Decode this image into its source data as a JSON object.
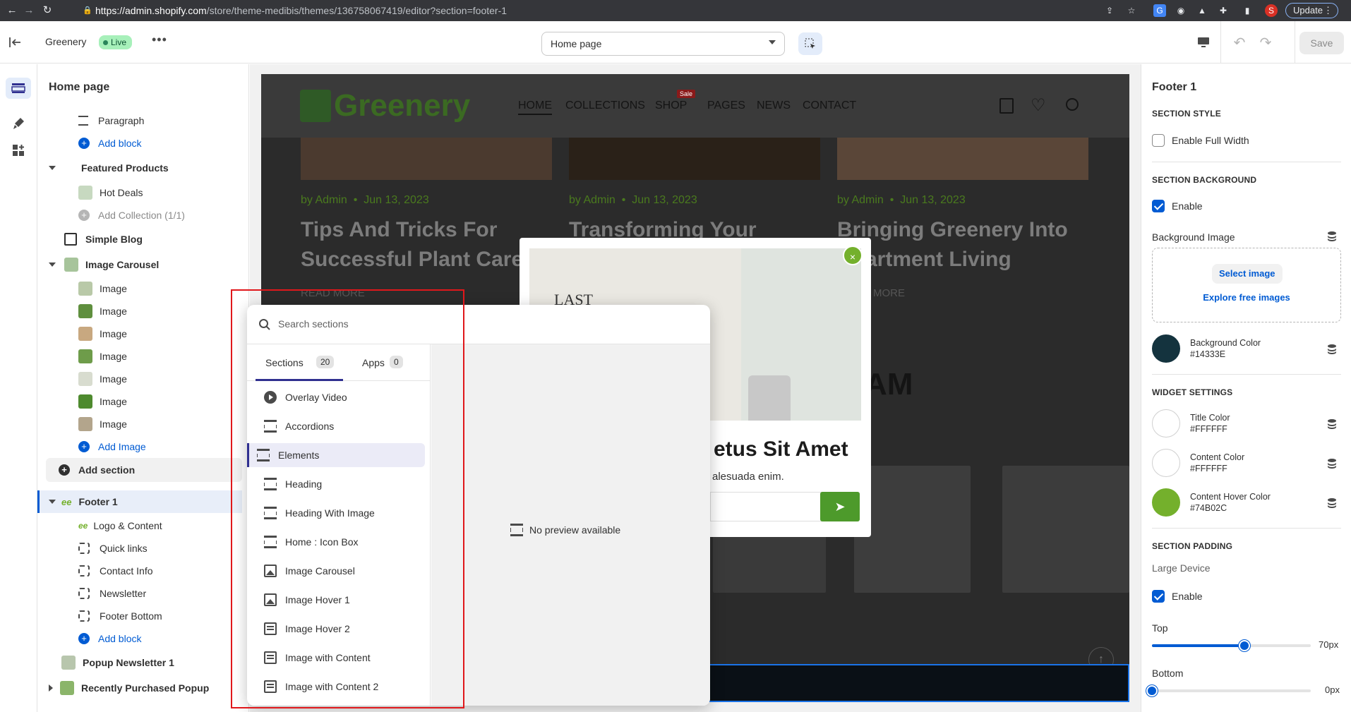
{
  "browser": {
    "url_host": "https://admin.shopify.com",
    "url_path": "/store/theme-medibis/themes/136758067419/editor?section=footer-1",
    "update_label": "Update",
    "profile_initial": "S"
  },
  "topbar": {
    "store_name": "Greenery",
    "status_badge": "Live",
    "page_select": "Home page",
    "save_label": "Save"
  },
  "left_panel": {
    "title": "Home page",
    "items": [
      {
        "label": "Paragraph"
      },
      {
        "label": "Add block"
      },
      {
        "label": "Featured Products"
      },
      {
        "label": "Hot Deals"
      },
      {
        "label": "Add Collection (1/1)"
      },
      {
        "label": "Simple Blog"
      },
      {
        "label": "Image Carousel"
      },
      {
        "label": "Image"
      },
      {
        "label": "Image"
      },
      {
        "label": "Image"
      },
      {
        "label": "Image"
      },
      {
        "label": "Image"
      },
      {
        "label": "Image"
      },
      {
        "label": "Image"
      },
      {
        "label": "Add Image"
      },
      {
        "label": "Add section"
      },
      {
        "label": "Footer 1"
      },
      {
        "label": "Logo & Content"
      },
      {
        "label": "Quick links"
      },
      {
        "label": "Contact Info"
      },
      {
        "label": "Newsletter"
      },
      {
        "label": "Footer Bottom"
      },
      {
        "label": "Add block"
      },
      {
        "label": "Popup Newsletter 1"
      },
      {
        "label": "Recently Purchased Popup"
      }
    ]
  },
  "store": {
    "logo": "Greenery",
    "nav": [
      "HOME",
      "COLLECTIONS",
      "SHOP",
      "PAGES",
      "NEWS",
      "CONTACT"
    ],
    "sale_badge": "Sale",
    "posts": [
      {
        "meta_author": "by Admin",
        "meta_date": "Jun 13, 2023",
        "title": "Tips And Tricks For Successful Plant Care",
        "read_more": "READ MORE"
      },
      {
        "meta_author": "by Admin",
        "meta_date": "Jun 13, 2023",
        "title": "Transforming Your",
        "read_more": ""
      },
      {
        "meta_author": "by Admin",
        "meta_date": "Jun 13, 2023",
        "title": "Bringing Greenery Into Apartment Living",
        "read_more": "MORE"
      }
    ],
    "bg_heading_fragment": "AM",
    "popup": {
      "heading_fragment": "etus Sit Amet",
      "text_fragment": "alesuada enim.",
      "card_text": "LAST"
    }
  },
  "picker": {
    "search_placeholder": "Search sections",
    "tabs": [
      {
        "label": "Sections",
        "count": "20"
      },
      {
        "label": "Apps",
        "count": "0"
      }
    ],
    "items": [
      {
        "label": "Overlay Video",
        "icon": "play-icon"
      },
      {
        "label": "Accordions",
        "icon": "section-icon"
      },
      {
        "label": "Elements",
        "icon": "section-icon"
      },
      {
        "label": "Heading",
        "icon": "section-icon"
      },
      {
        "label": "Heading With Image",
        "icon": "section-icon"
      },
      {
        "label": "Home : Icon Box",
        "icon": "section-icon"
      },
      {
        "label": "Image Carousel",
        "icon": "image-icon"
      },
      {
        "label": "Image Hover 1",
        "icon": "image-icon"
      },
      {
        "label": "Image Hover 2",
        "icon": "text-icon"
      },
      {
        "label": "Image with Content",
        "icon": "text-icon"
      },
      {
        "label": "Image with Content 2",
        "icon": "text-icon"
      }
    ],
    "preview_text": "No preview available"
  },
  "right_panel": {
    "title": "Footer 1",
    "section_style": "SECTION STYLE",
    "enable_full_width": "Enable Full Width",
    "section_background": "SECTION BACKGROUND",
    "enable": "Enable",
    "background_image": "Background Image",
    "select_image": "Select image",
    "explore_free_images": "Explore free images",
    "background_color_label": "Background Color",
    "background_color_value": "#14333E",
    "widget_settings": "WIDGET SETTINGS",
    "title_color_label": "Title Color",
    "title_color_value": "#FFFFFF",
    "content_color_label": "Content Color",
    "content_color_value": "#FFFFFF",
    "content_hover_label": "Content Hover Color",
    "content_hover_value": "#74B02C",
    "section_padding": "SECTION PADDING",
    "large_device": "Large Device",
    "enable2": "Enable",
    "top_label": "Top",
    "top_value": "70px",
    "top_fraction": 0.58,
    "bottom_label": "Bottom",
    "bottom_value": "0px",
    "bottom_fraction": 0.0
  },
  "colors": {
    "accent": "#005bd3",
    "live_badge": "#a7f0ba",
    "brand_green": "#74B02C",
    "highlight": "#e0171b"
  }
}
